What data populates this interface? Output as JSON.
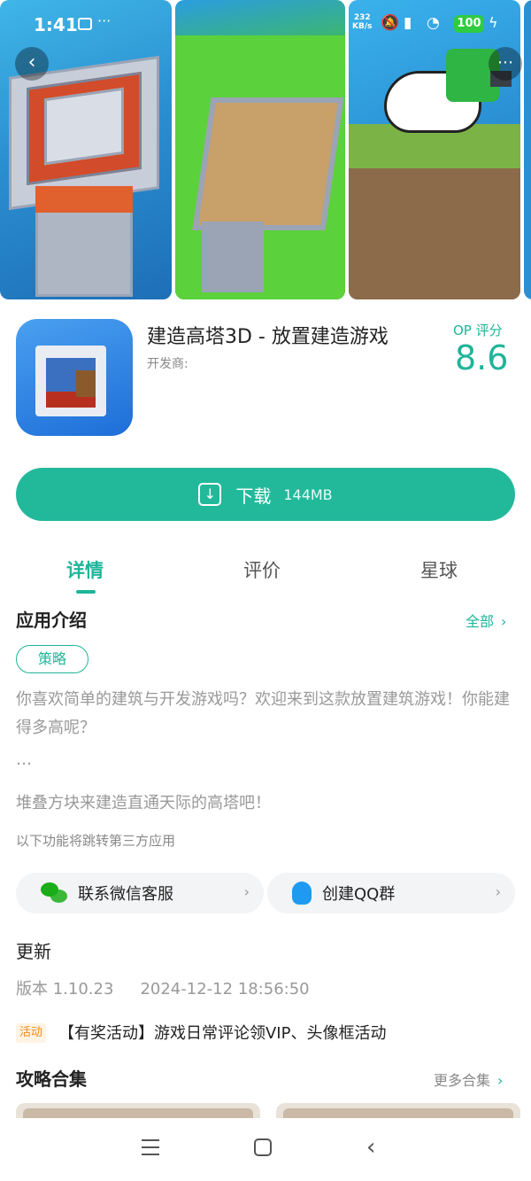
{
  "status_bar": {
    "time": "1:41",
    "net_speed_value": "232",
    "net_speed_unit": "KB/s",
    "battery": "100"
  },
  "app": {
    "title": "建造高塔3D - 放置建造游戏",
    "developer_label": "开发商:",
    "rating_label": "OP 评分",
    "rating_value": "8.6"
  },
  "download": {
    "label": "下载",
    "size": "144MB"
  },
  "tabs": [
    {
      "label": "详情",
      "active": true
    },
    {
      "label": "评价",
      "active": false
    },
    {
      "label": "星球",
      "active": false
    }
  ],
  "intro": {
    "title": "应用介绍",
    "more_label": "全部",
    "tag": "策略",
    "description": "你喜欢简单的建筑与开发游戏吗？欢迎来到这款放置建筑游戏！你能建得多高呢？",
    "ellipsis": "…",
    "tagline": "堆叠方块来建造直通天际的高塔吧！",
    "note": "以下功能将跳转第三方应用"
  },
  "third_party": {
    "wechat_label": "联系微信客服",
    "qq_label": "创建QQ群"
  },
  "update": {
    "title": "更新",
    "version": "版本 1.10.23",
    "datetime": "2024-12-12 18:56:50"
  },
  "activity": {
    "badge": "活动",
    "text": "【有奖活动】游戏日常评论领VIP、头像框活动"
  },
  "guides": {
    "title": "攻略合集",
    "more_label": "更多合集"
  }
}
